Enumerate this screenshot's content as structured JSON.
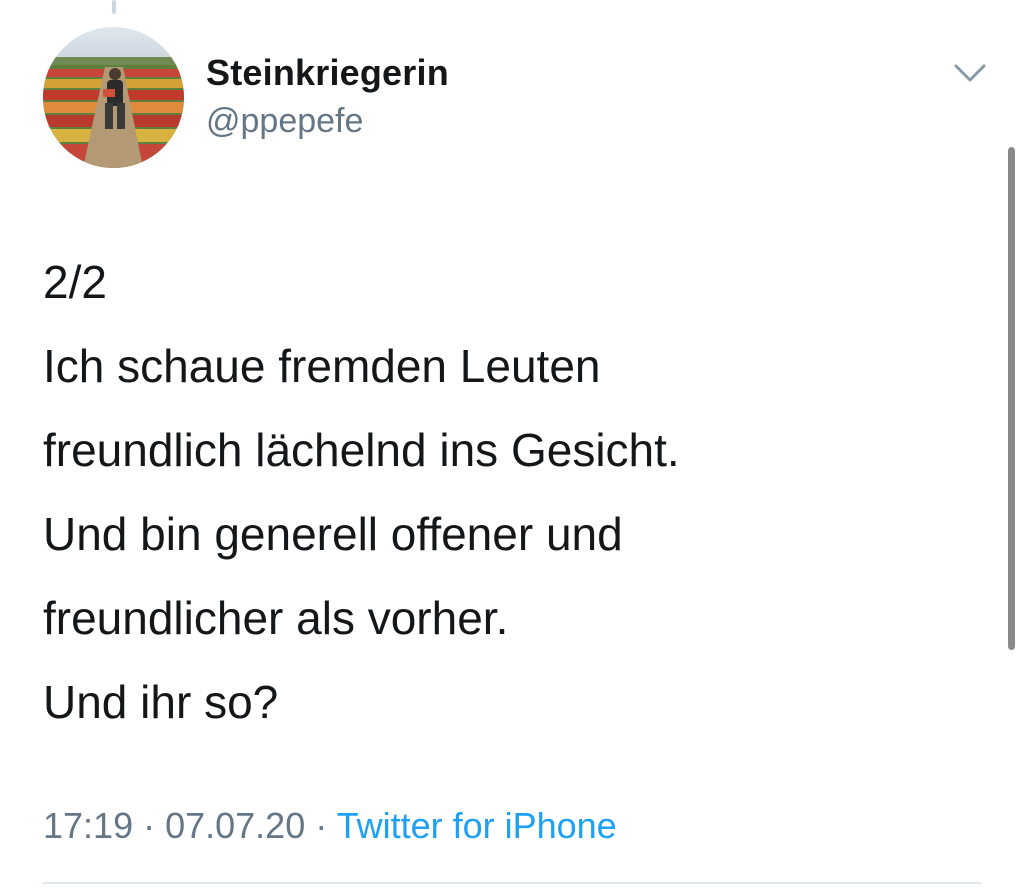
{
  "tweet": {
    "author": {
      "display_name": "Steinkriegerin",
      "handle": "@ppepefe",
      "avatar_icon": "profile-photo-tulip-field"
    },
    "menu_icon": "chevron-down-icon",
    "text_lines": [
      "2/2",
      "Ich schaue fremden Leuten",
      "freundlich lächelnd ins Gesicht.",
      "Und bin generell offener und",
      "freundlicher als vorher.",
      "Und ihr so?"
    ],
    "meta": {
      "time": "17:19",
      "separator": " · ",
      "date": "07.07.20",
      "source": "Twitter for iPhone"
    }
  },
  "colors": {
    "text": "#14171a",
    "secondary": "#657786",
    "link": "#1da1f2",
    "divider": "#e1e8ed"
  }
}
